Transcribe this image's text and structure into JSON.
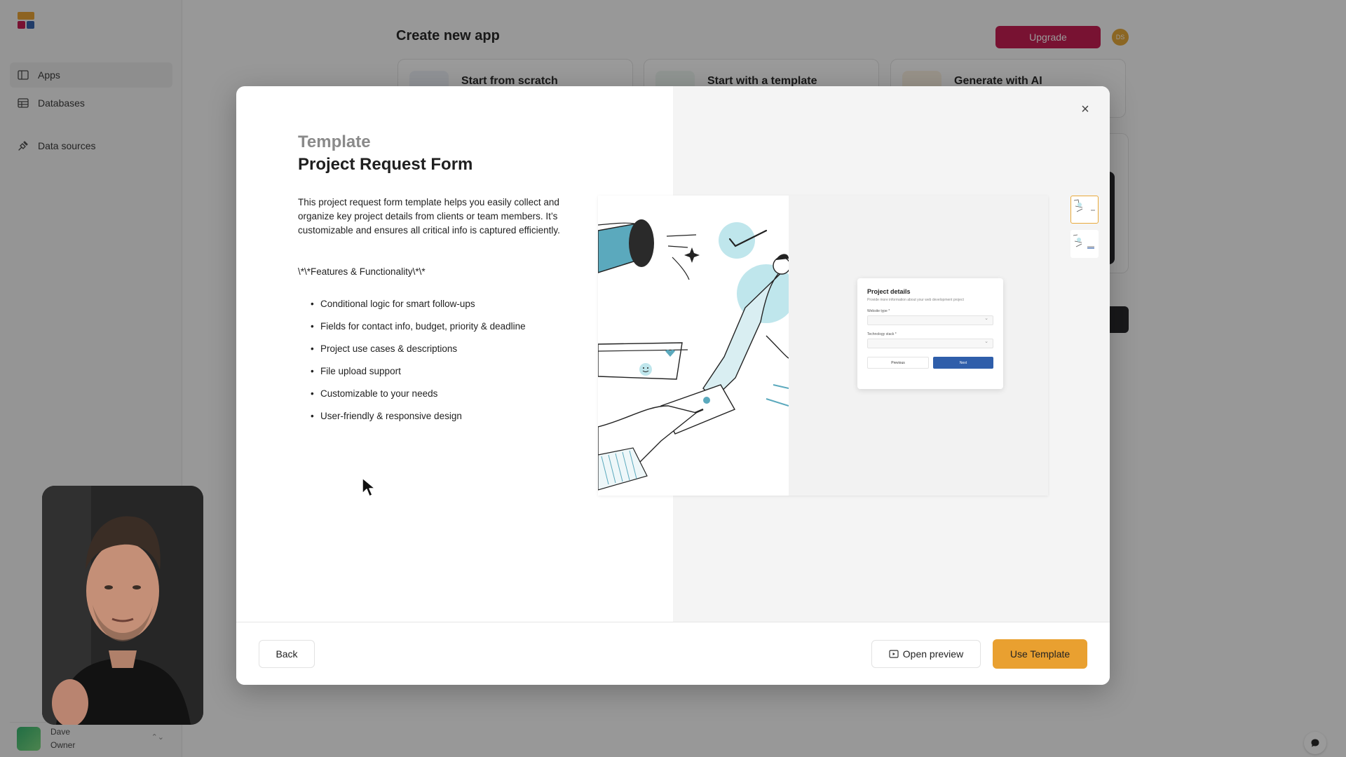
{
  "sidebar": {
    "items": [
      {
        "label": "Apps",
        "icon": "apps-icon",
        "active": true
      },
      {
        "label": "Databases",
        "icon": "database-icon",
        "active": false
      },
      {
        "label": "Data sources",
        "icon": "plug-icon",
        "active": false
      }
    ],
    "user": {
      "name": "Dave",
      "role": "Owner"
    }
  },
  "header": {
    "title": "Create new app",
    "upgrade_label": "Upgrade",
    "avatar_initials": "DS"
  },
  "options": [
    {
      "label": "Start from scratch"
    },
    {
      "label": "Start with a template"
    },
    {
      "label": "Generate with AI"
    }
  ],
  "modal": {
    "eyebrow": "Template",
    "title": "Project Request Form",
    "description": "This project request form template helps you easily collect and organize key project details from clients or team members. It’s customizable and ensures all critical info is captured efficiently.",
    "features_heading": "\\*\\*Features & Functionality\\*\\*",
    "features": [
      "Conditional logic for smart follow-ups",
      "Fields for contact info, budget, priority & deadline",
      "Project use cases & descriptions",
      "File upload support",
      "Customizable to your needs",
      "User-friendly & responsive design"
    ],
    "preview": {
      "form_title": "Project details",
      "form_subtitle": "Provide more information about your web development project",
      "field1_label": "Website type *",
      "field2_label": "Technology stack *",
      "prev_label": "Previous",
      "next_label": "Next"
    },
    "footer": {
      "back_label": "Back",
      "open_preview_label": "Open preview",
      "use_template_label": "Use Template"
    }
  },
  "colors": {
    "upgrade": "#c5164d",
    "use_template": "#e9a030",
    "form_next": "#2f5eaa",
    "thumb_active": "#e8a93a"
  }
}
